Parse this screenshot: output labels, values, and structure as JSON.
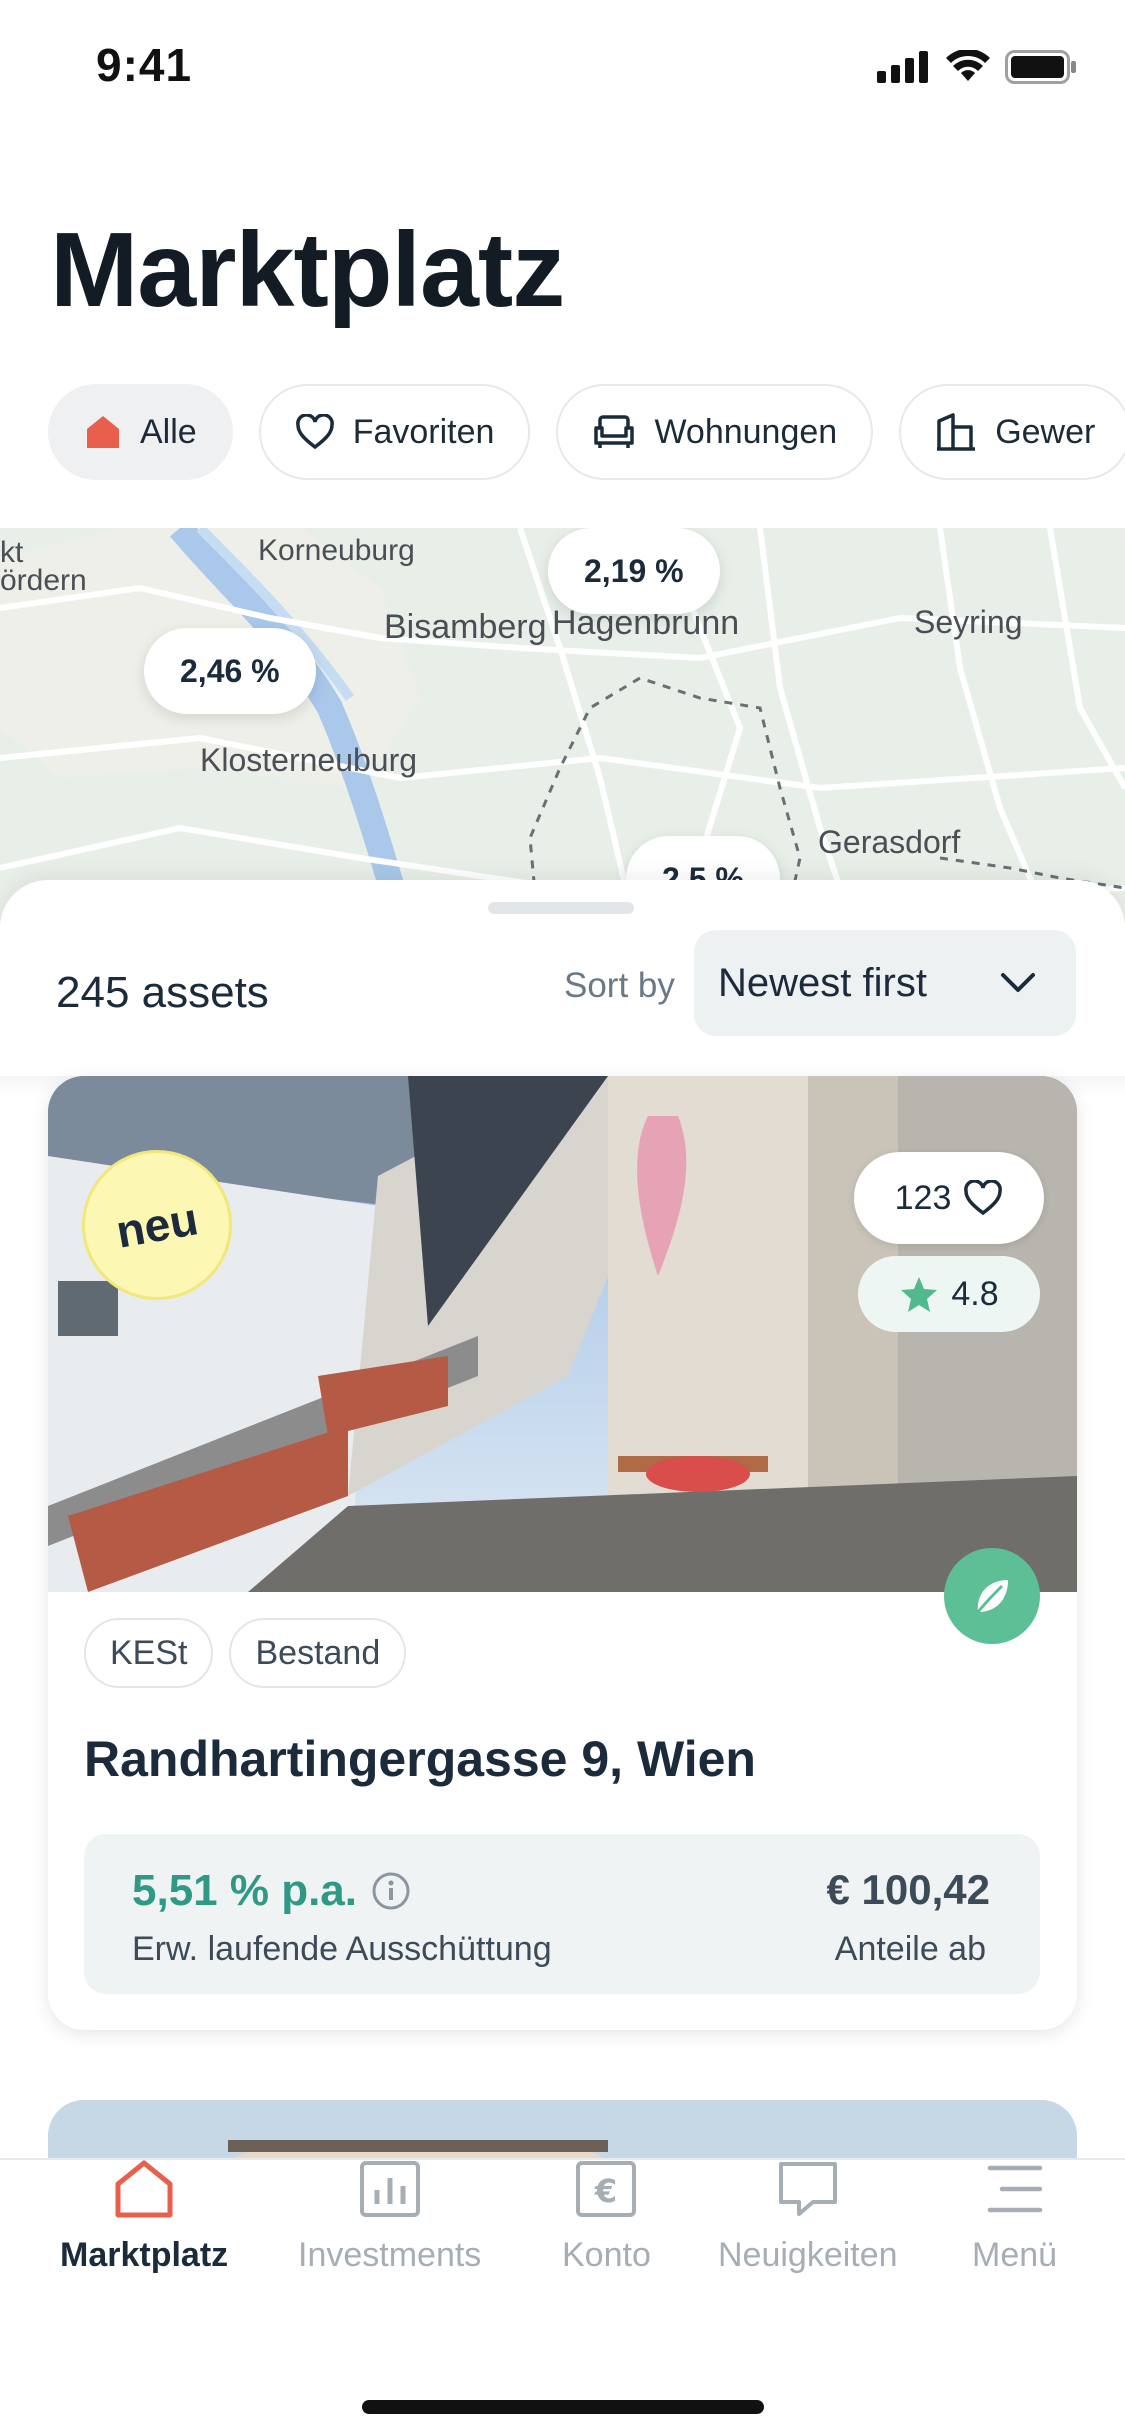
{
  "status_bar": {
    "time": "9:41"
  },
  "header": {
    "title": "Marktplatz"
  },
  "filters": [
    {
      "label": "Alle",
      "icon": "house-filled-icon",
      "active": true
    },
    {
      "label": "Favoriten",
      "icon": "heart-icon",
      "active": false
    },
    {
      "label": "Wohnungen",
      "icon": "sofa-icon",
      "active": false
    },
    {
      "label": "Gewer",
      "icon": "building-icon",
      "active": false
    }
  ],
  "map": {
    "pins": [
      "2,19 %",
      "2,46 %",
      "2,5 %"
    ],
    "labels": [
      "Korneuburg",
      "Bisamberg",
      "Hagenbrunn",
      "Seyring",
      "Klosterneuburg",
      "Gerasdorf",
      "kt",
      "ördern"
    ]
  },
  "list": {
    "count_label": "245 assets",
    "sort_label": "Sort by",
    "sort_value": "Newest first"
  },
  "card": {
    "badge": "neu",
    "favorites_count": "123",
    "rating": "4.8",
    "tags": [
      "KESt",
      "Bestand"
    ],
    "address": "Randhartingergasse 9, Wien",
    "yield": "5,51 % p.a.",
    "yield_label": "Erw. laufende Ausschüttung",
    "price": "€ 100,42",
    "price_label": "Anteile ab",
    "colors": {
      "accent_green": "#2e9a85",
      "eco_green": "#5dbf96"
    }
  },
  "tabbar": {
    "items": [
      {
        "label": "Marktplatz",
        "icon": "home-icon",
        "active": true
      },
      {
        "label": "Investments",
        "icon": "chart-icon",
        "active": false
      },
      {
        "label": "Konto",
        "icon": "euro-icon",
        "active": false
      },
      {
        "label": "Neuigkeiten",
        "icon": "message-icon",
        "active": false
      },
      {
        "label": "Menü",
        "icon": "menu-icon",
        "active": false
      }
    ],
    "colors": {
      "active": "#e8604c",
      "inactive": "#a6adb5"
    }
  }
}
